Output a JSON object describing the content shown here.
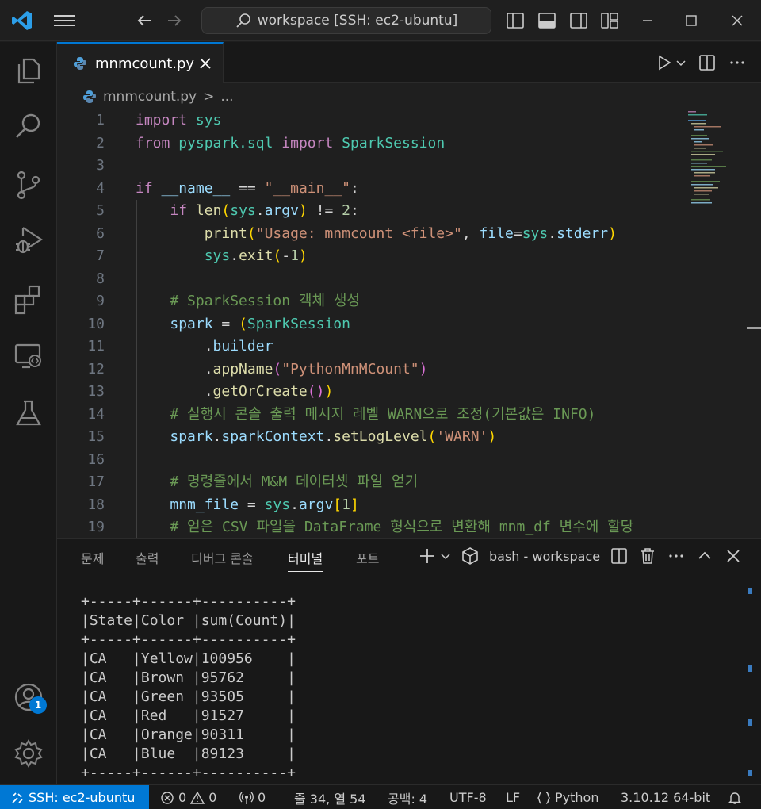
{
  "titlebar": {
    "search_text": "workspace [SSH: ec2-ubuntu]"
  },
  "tab": {
    "label": "mnmcount.py"
  },
  "breadcrumb": {
    "file": "mnmcount.py",
    "separator": ">",
    "more": "..."
  },
  "editor": {
    "line_numbers": [
      "1",
      "2",
      "3",
      "4",
      "5",
      "6",
      "7",
      "8",
      "9",
      "10",
      "11",
      "12",
      "13",
      "14",
      "15",
      "16",
      "17",
      "18",
      "19"
    ],
    "lines": [
      "import sys",
      "from pyspark.sql import SparkSession",
      "",
      "if __name__ == \"__main__\":",
      "    if len(sys.argv) != 2:",
      "        print(\"Usage: mnmcount <file>\", file=sys.stderr)",
      "        sys.exit(-1)",
      "",
      "    # SparkSession 객체 생성",
      "    spark = (SparkSession",
      "        .builder",
      "        .appName(\"PythonMnMCount\")",
      "        .getOrCreate())",
      "    # 실행시 콘솔 출력 메시지 레벨 WARN으로 조정(기본값은 INFO)",
      "    spark.sparkContext.setLogLevel('WARN')",
      "",
      "    # 명령줄에서 M&M 데이터셋 파일 얻기",
      "    mnm_file = sys.argv[1]",
      "    # 얻은 CSV 파일을 DataFrame 형식으로 변환해 mnm_df 변수에 할당"
    ]
  },
  "panel": {
    "tabs": [
      "문제",
      "출력",
      "디버그 콘솔",
      "터미널",
      "포트"
    ],
    "active_tab": "터미널",
    "terminal_name": "bash - workspace",
    "terminal_lines": [
      "+-----+------+----------+",
      "|State|Color |sum(Count)|",
      "+-----+------+----------+",
      "|CA   |Yellow|100956    |",
      "|CA   |Brown |95762     |",
      "|CA   |Green |93505     |",
      "|CA   |Red   |91527     |",
      "|CA   |Orange|90311     |",
      "|CA   |Blue  |89123     |",
      "+-----+------+----------+"
    ]
  },
  "accounts_badge": "1",
  "statusbar": {
    "remote": "SSH: ec2-ubuntu",
    "errors": "0",
    "warnings": "0",
    "ports": "0",
    "position": "줄 34, 열 54",
    "spaces": "공백: 4",
    "encoding": "UTF-8",
    "eol": "LF",
    "language": "Python",
    "interpreter": "3.10.12 64-bit"
  },
  "colors": {
    "accent": "#0078d4",
    "background": "#1f1f1f",
    "sidebar": "#181818"
  }
}
